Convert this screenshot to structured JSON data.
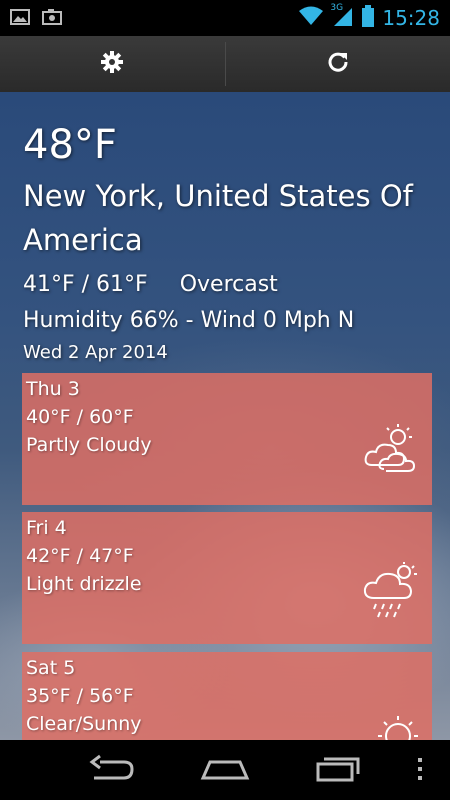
{
  "status_bar": {
    "network": "3G",
    "time": "15:28"
  },
  "current": {
    "temperature": "48°F",
    "location": "New York, United States Of America",
    "range": "41°F / 61°F",
    "condition": "Overcast",
    "details": "Humidity 66% - Wind 0 Mph N",
    "date": "Wed 2 Apr 2014"
  },
  "forecast": [
    {
      "day": "Thu 3",
      "range": "40°F / 60°F",
      "condition": "Partly Cloudy",
      "icon": "partly-cloudy-icon"
    },
    {
      "day": "Fri 4",
      "range": "42°F / 47°F",
      "condition": "Light drizzle",
      "icon": "drizzle-icon"
    },
    {
      "day": "Sat 5",
      "range": "35°F / 56°F",
      "condition": "Clear/Sunny",
      "icon": "sun-icon"
    }
  ],
  "colors": {
    "card": "#de6e64",
    "clock": "#33b5e5"
  }
}
